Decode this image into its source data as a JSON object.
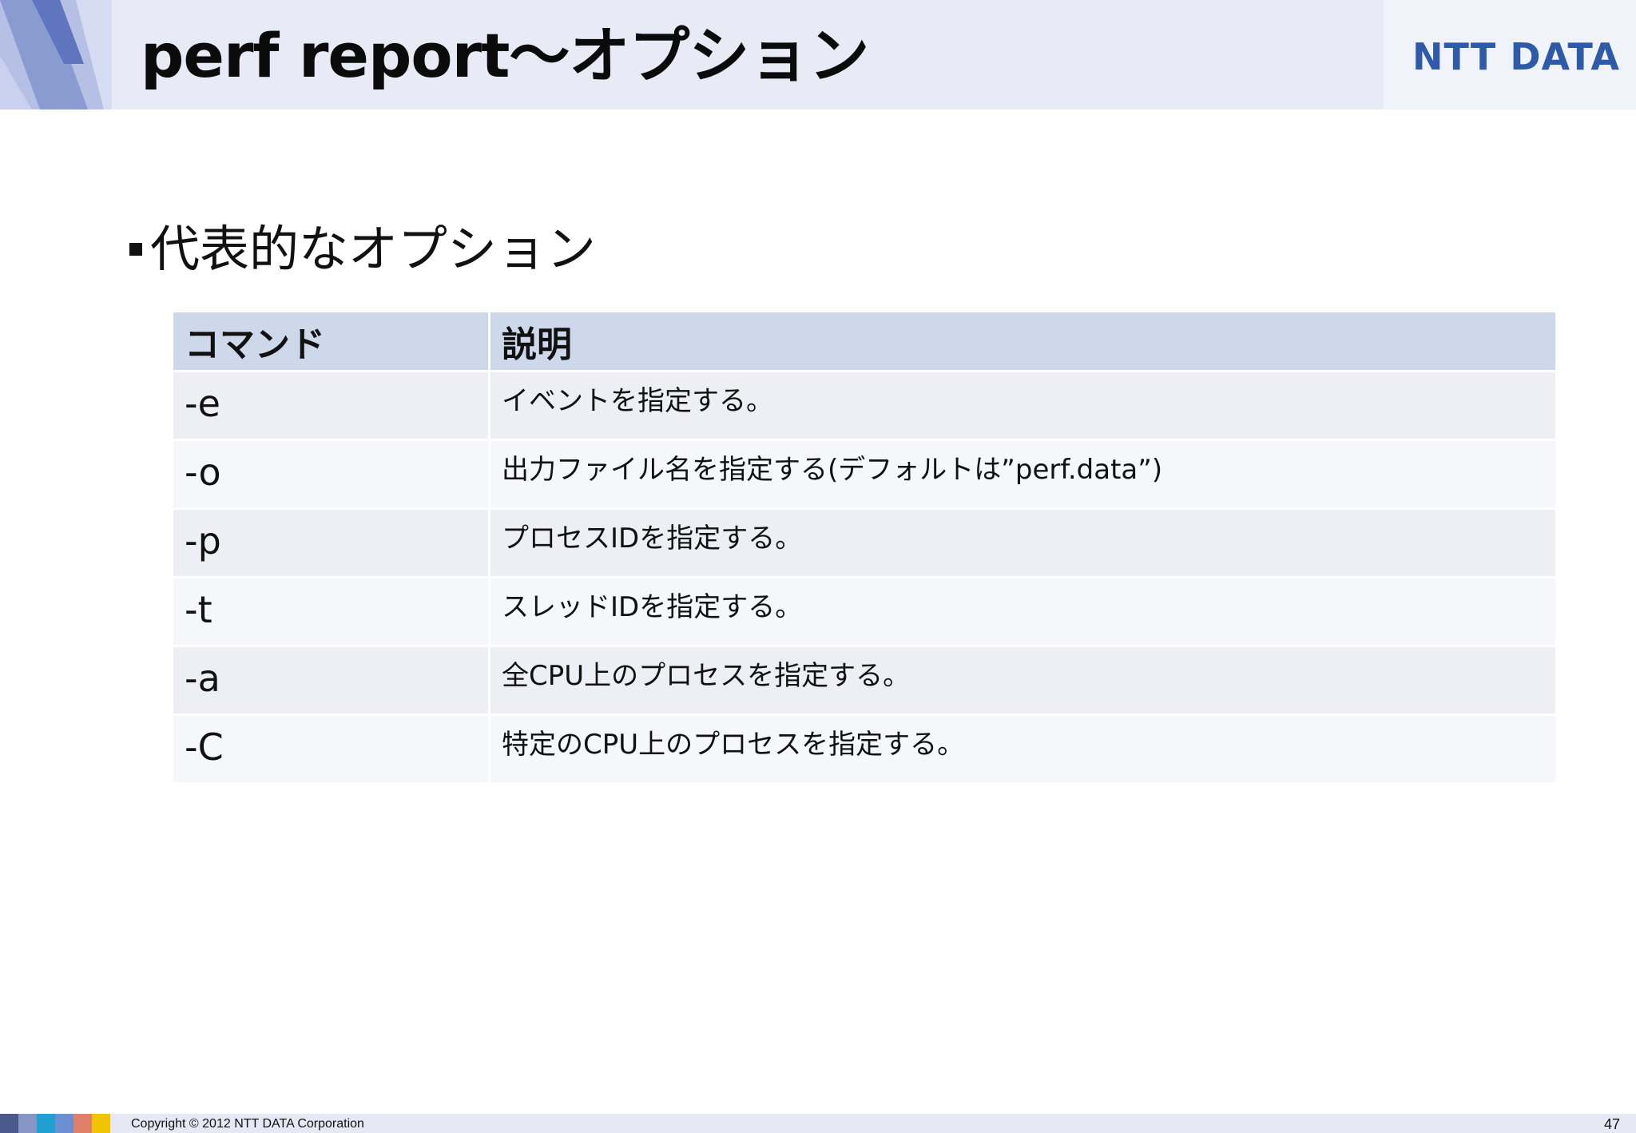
{
  "header": {
    "title": "perf report～オプション",
    "logo_text": "NTT DATA"
  },
  "section": {
    "heading": "代表的なオプション"
  },
  "table": {
    "headers": [
      "コマンド",
      "説明"
    ],
    "rows": [
      {
        "cmd": "-e",
        "desc": "イベントを指定する。"
      },
      {
        "cmd": "-o",
        "desc": "出力ファイル名を指定する(デフォルトは”perf.data”)"
      },
      {
        "cmd": "-p",
        "desc": "プロセスIDを指定する。"
      },
      {
        "cmd": "-t",
        "desc": "スレッドIDを指定する。"
      },
      {
        "cmd": "-a",
        "desc": "全CPU上のプロセスを指定する。"
      },
      {
        "cmd": "-C",
        "desc": "特定のCPU上のプロセスを指定する。"
      }
    ]
  },
  "footer": {
    "copyright": "Copyright © 2012 NTT DATA Corporation",
    "page_number": "47",
    "swatch_colors": [
      "#4a5a8c",
      "#8596c4",
      "#1fa0d0",
      "#6b8fd0",
      "#e0806a",
      "#f0c400"
    ]
  },
  "colors": {
    "header_bg": "#e8ebf6",
    "logo": "#2f5aa8",
    "table_header_bg": "#cdd8ea",
    "row_odd_bg": "#eeeff5",
    "row_even_bg": "#f6f7fb"
  }
}
